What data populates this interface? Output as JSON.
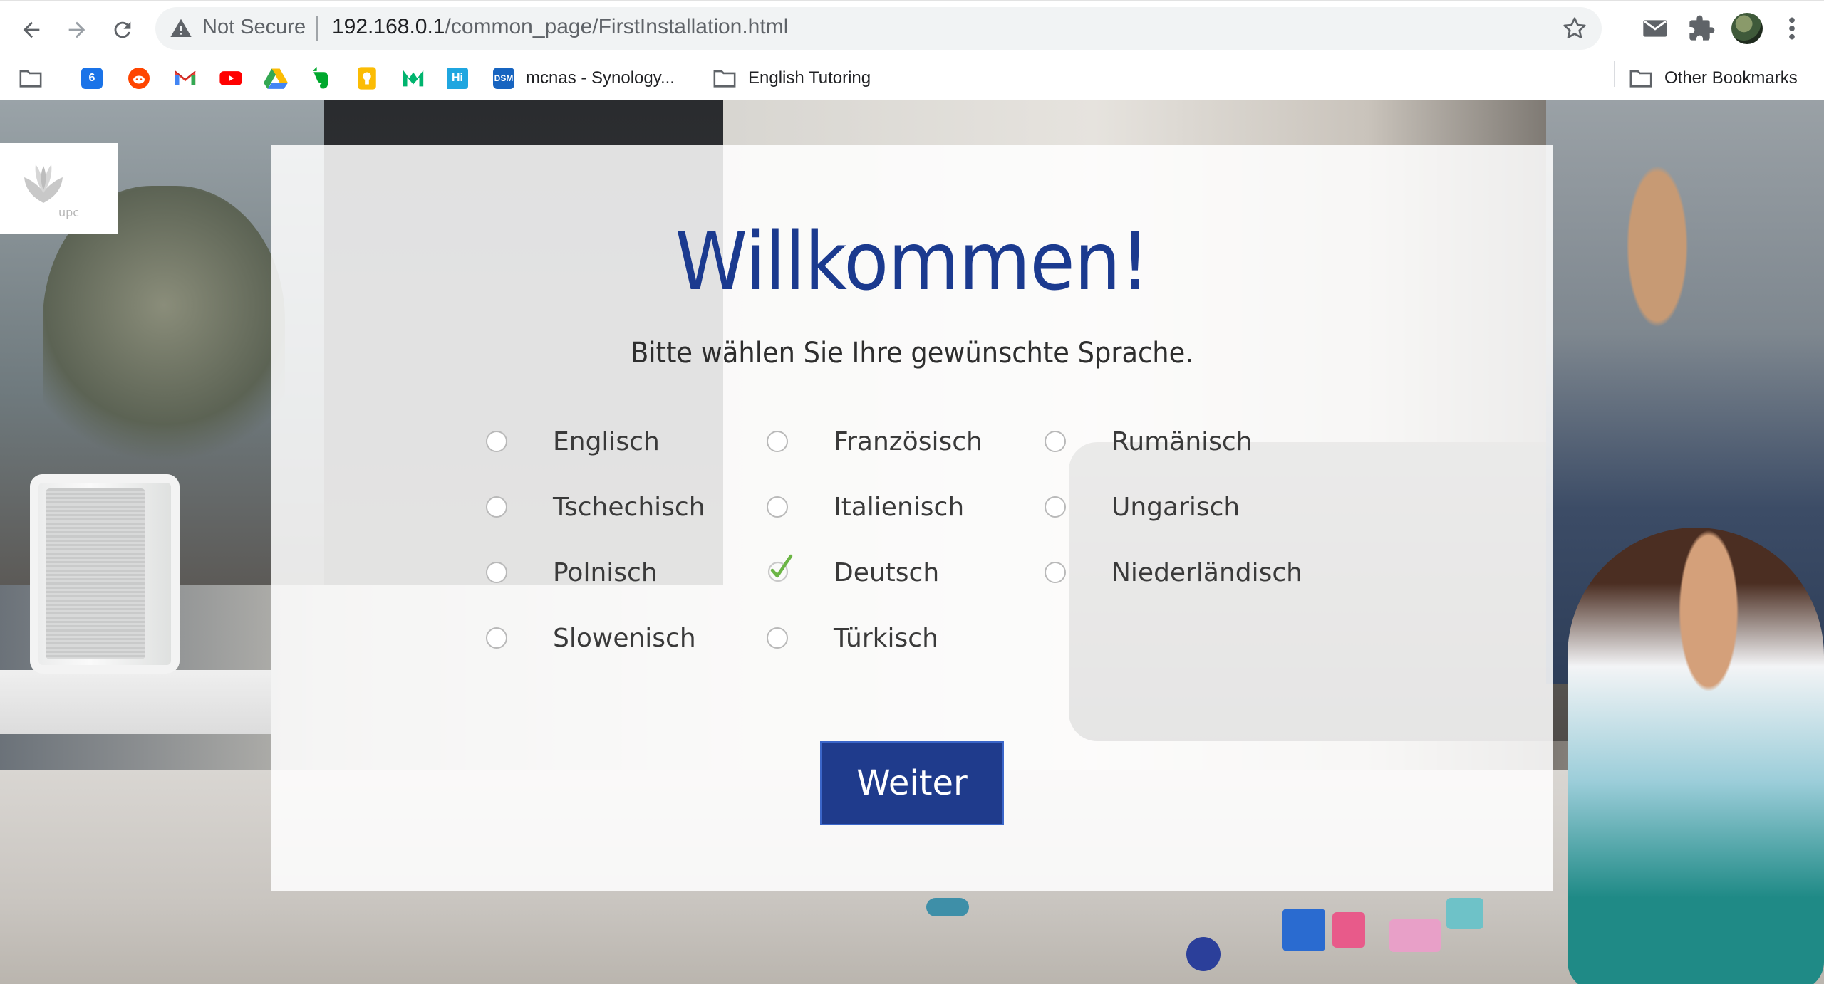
{
  "browser": {
    "security_label": "Not Secure",
    "url_host": "192.168.0.1",
    "url_path": "/common_page/FirstInstallation.html",
    "icons": [
      "back-arrow-icon",
      "forward-arrow-icon",
      "reload-icon",
      "warning-icon",
      "star-icon",
      "mail-icon",
      "extensions-icon",
      "avatar",
      "more-icon"
    ]
  },
  "bookmarks": {
    "items": [
      {
        "label": "",
        "icon": "folder-icon"
      },
      {
        "label": "",
        "icon": "calendar-icon",
        "badge": "6"
      },
      {
        "label": "",
        "icon": "reddit-icon"
      },
      {
        "label": "",
        "icon": "gmail-icon"
      },
      {
        "label": "",
        "icon": "youtube-icon"
      },
      {
        "label": "",
        "icon": "drive-icon"
      },
      {
        "label": "",
        "icon": "evernote-icon"
      },
      {
        "label": "",
        "icon": "keep-icon"
      },
      {
        "label": "",
        "icon": "m-icon"
      },
      {
        "label": "",
        "icon": "hi-icon",
        "badge": "Hi"
      },
      {
        "label": "mcnas - Synology...",
        "icon": "dsm-icon",
        "badge": "DSM"
      },
      {
        "label": "English Tutoring",
        "icon": "folder-icon"
      }
    ],
    "other_bookmarks": "Other Bookmarks"
  },
  "brand": {
    "logo_text": "upc"
  },
  "welcome": {
    "title": "Willkommen!",
    "subtitle": "Bitte wählen Sie Ihre gewünschte Sprache.",
    "languages": [
      {
        "label": "Englisch",
        "checked": false
      },
      {
        "label": "Französisch",
        "checked": false
      },
      {
        "label": "Rumänisch",
        "checked": false
      },
      {
        "label": "Tschechisch",
        "checked": false
      },
      {
        "label": "Italienisch",
        "checked": false
      },
      {
        "label": "Ungarisch",
        "checked": false
      },
      {
        "label": "Polnisch",
        "checked": false
      },
      {
        "label": "Deutsch",
        "checked": true
      },
      {
        "label": "Niederländisch",
        "checked": false
      },
      {
        "label": "Slowenisch",
        "checked": false
      },
      {
        "label": "Türkisch",
        "checked": false
      }
    ],
    "selected_language": "Deutsch",
    "continue_label": "Weiter"
  },
  "colors": {
    "brand_blue": "#1f3b8c",
    "check_green": "#6bb545"
  }
}
